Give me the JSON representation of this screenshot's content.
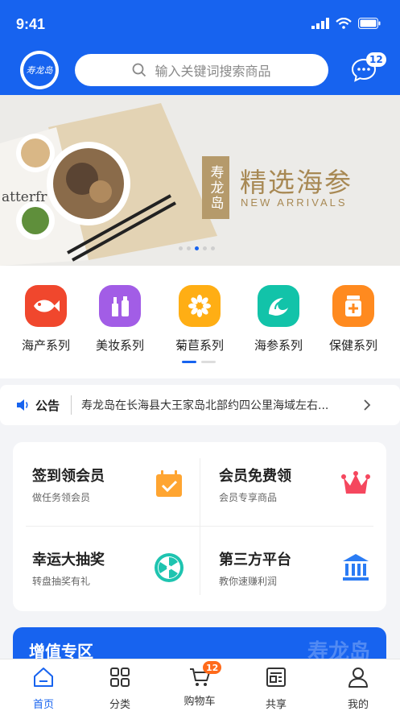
{
  "status_bar": {
    "time": "9:41"
  },
  "header": {
    "logo_text": "寿龙岛",
    "search_placeholder": "输入关键词搜索商品",
    "message_badge": "12"
  },
  "banner": {
    "brand": "寿龙岛",
    "title": "精选海参",
    "subtitle": "NEW ARRIVALS",
    "page_count": 5,
    "active_page": 3
  },
  "categories": [
    {
      "label": "海产系列",
      "icon": "fish-icon",
      "color": "#f0472d"
    },
    {
      "label": "美妆系列",
      "icon": "cosmetics-icon",
      "color": "#a25de6"
    },
    {
      "label": "菊苣系列",
      "icon": "flower-icon",
      "color": "#ffae14"
    },
    {
      "label": "海参系列",
      "icon": "wave-icon",
      "color": "#12c3a9"
    },
    {
      "label": "保健系列",
      "icon": "medicine-icon",
      "color": "#ff8a1f"
    }
  ],
  "notice": {
    "label": "公告",
    "text": "寿龙岛在长海县大王家岛北部约四公里海域左右..."
  },
  "member": [
    {
      "title": "签到领会员",
      "sub": "做任务领会员",
      "icon": "calendar-check-icon"
    },
    {
      "title": "会员免费领",
      "sub": "会员专享商品",
      "icon": "crown-icon"
    },
    {
      "title": "幸运大抽奖",
      "sub": "转盘抽奖有礼",
      "icon": "wheel-icon"
    },
    {
      "title": "第三方平台",
      "sub": "教你速赚利润",
      "icon": "bank-icon"
    }
  ],
  "value_area": {
    "title": "增值专区",
    "watermark": "寿龙岛"
  },
  "tabbar": [
    {
      "label": "首页",
      "icon": "home-icon",
      "active": true
    },
    {
      "label": "分类",
      "icon": "category-icon",
      "active": false
    },
    {
      "label": "购物车",
      "icon": "cart-icon",
      "active": false,
      "badge": "12"
    },
    {
      "label": "共享",
      "icon": "share-icon",
      "active": false
    },
    {
      "label": "我的",
      "icon": "user-icon",
      "active": false
    }
  ],
  "colors": {
    "primary": "#1763ef",
    "badge": "#ff6a1a",
    "gold": "#a88954"
  }
}
